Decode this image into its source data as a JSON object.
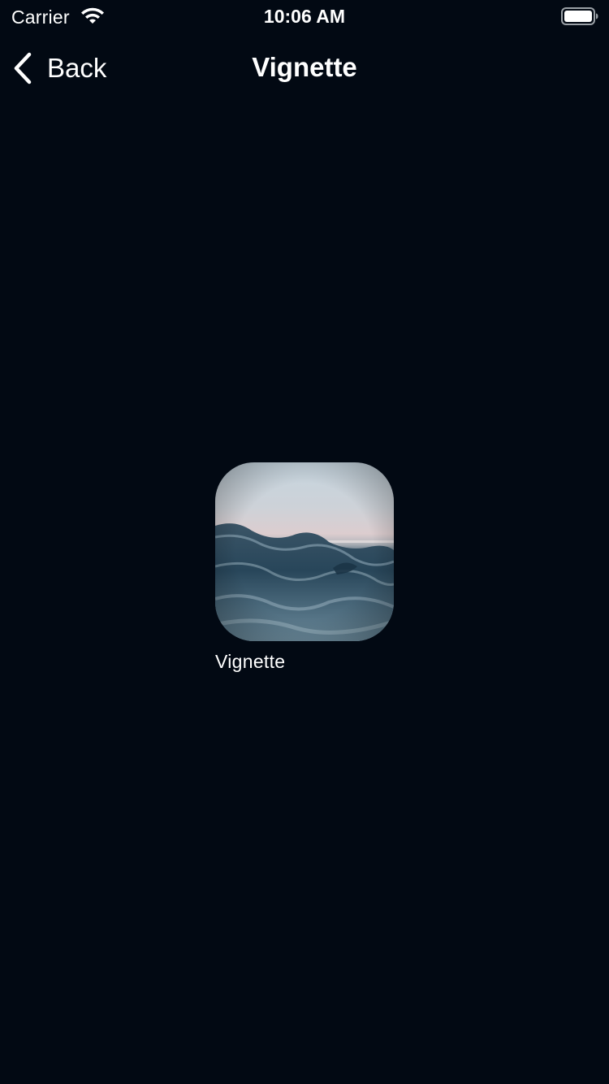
{
  "status_bar": {
    "carrier": "Carrier",
    "time": "10:06 AM",
    "icons": [
      "wifi-icon",
      "battery-icon"
    ]
  },
  "nav": {
    "back_label": "Back",
    "back_icon": "chevron-left-icon",
    "title": "Vignette"
  },
  "tile": {
    "label": "Vignette",
    "image_subject": "ocean-waves-photo"
  },
  "colors": {
    "background": "#020913",
    "text": "#ffffff"
  }
}
